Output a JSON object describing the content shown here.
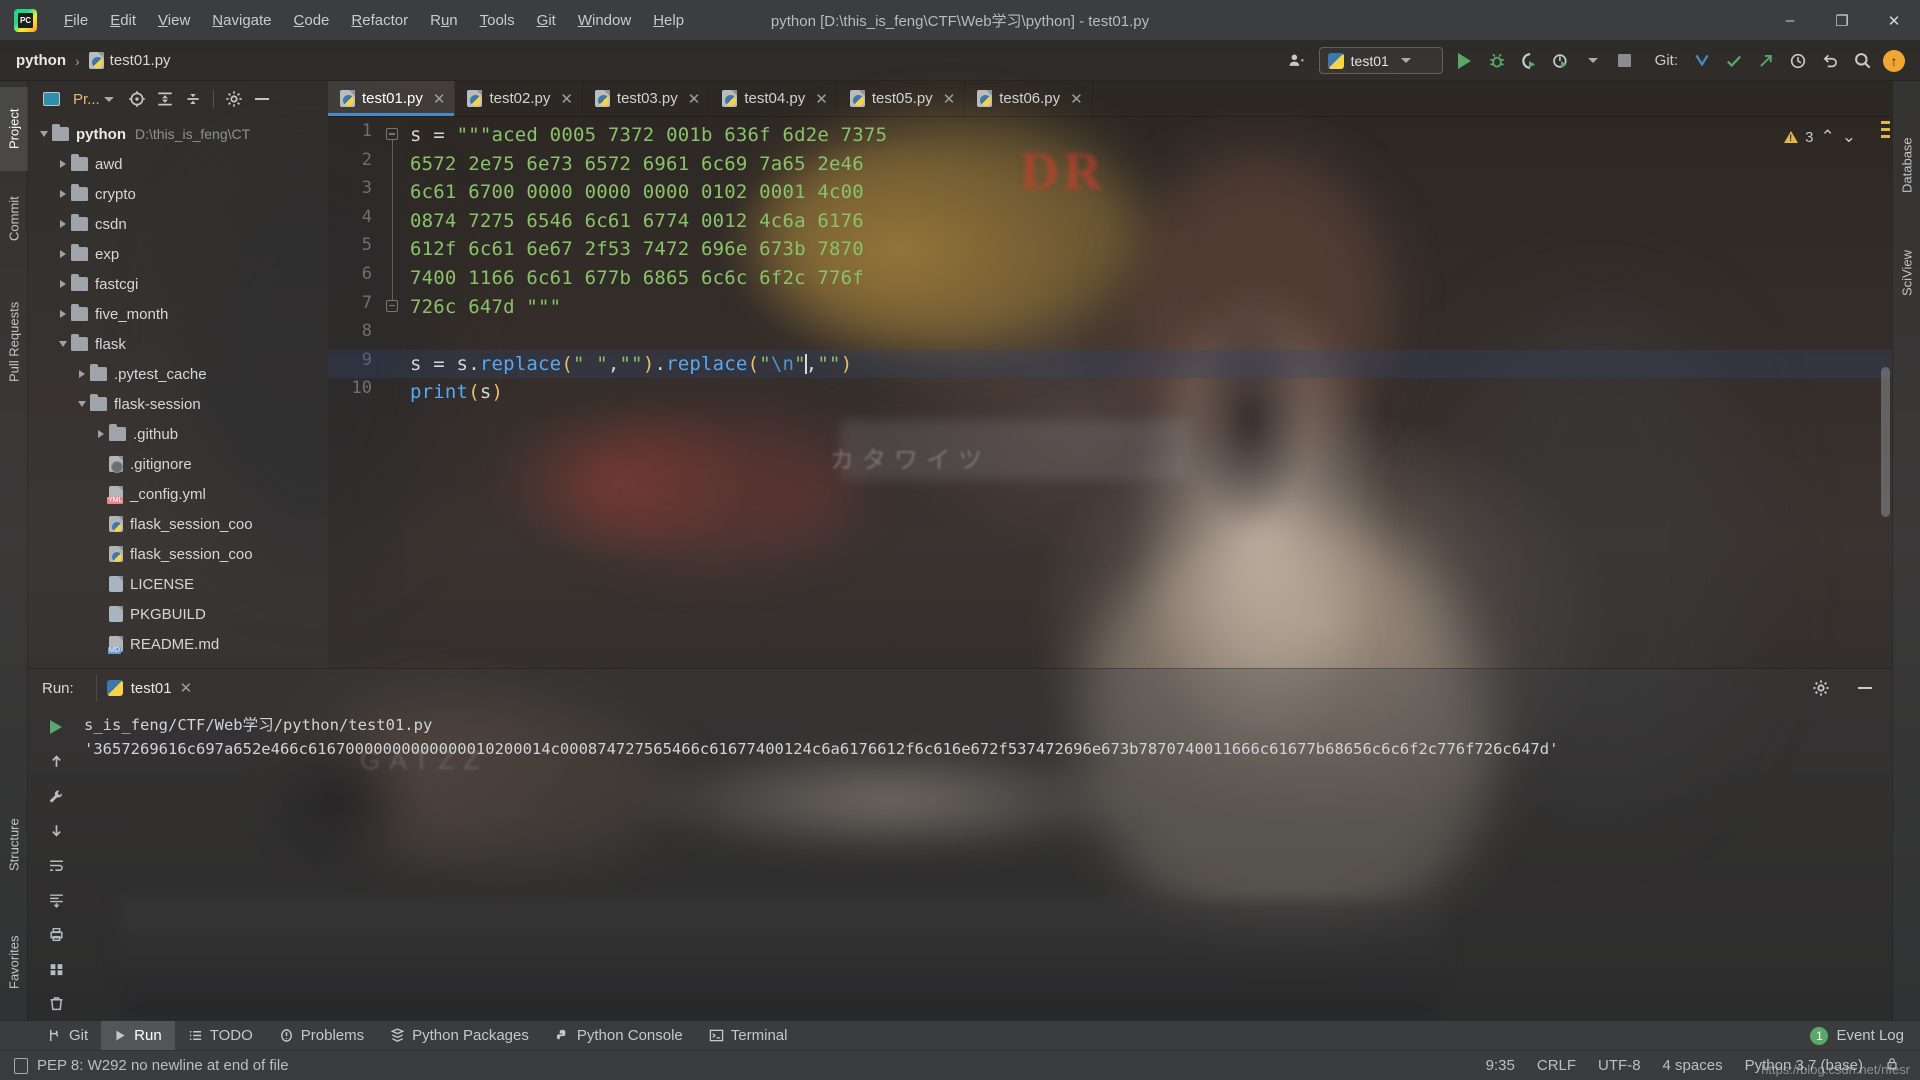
{
  "window": {
    "title": "python [D:\\this_is_feng\\CTF\\Web学习\\python] - test01.py",
    "app_icon": "pycharm-logo-icon",
    "minimize": "–",
    "maximize": "❐",
    "close": "✕"
  },
  "menubar": {
    "items": [
      {
        "label": "File",
        "mnemonic": "F"
      },
      {
        "label": "Edit",
        "mnemonic": "E"
      },
      {
        "label": "View",
        "mnemonic": "V"
      },
      {
        "label": "Navigate",
        "mnemonic": "N"
      },
      {
        "label": "Code",
        "mnemonic": "C"
      },
      {
        "label": "Refactor",
        "mnemonic": "R"
      },
      {
        "label": "Run",
        "mnemonic": "u"
      },
      {
        "label": "Tools",
        "mnemonic": "T"
      },
      {
        "label": "Git",
        "mnemonic": "G"
      },
      {
        "label": "Window",
        "mnemonic": "W"
      },
      {
        "label": "Help",
        "mnemonic": "H"
      }
    ]
  },
  "navbar": {
    "breadcrumb": {
      "project": "python",
      "separator": "›",
      "file": "test01.py"
    },
    "run_config": {
      "name": "test01",
      "icon": "python-config-icon"
    },
    "git_label": "Git:",
    "icons": [
      "account-icon",
      "run-icon",
      "debug-icon",
      "run-coverage-icon",
      "profile-icon",
      "stop-icon",
      "git-update-icon",
      "git-commit-icon",
      "git-push-icon",
      "history-icon",
      "rollback-icon",
      "search-everywhere-icon",
      "updates-badge-icon"
    ],
    "updates_badge": "↑"
  },
  "left_strip": {
    "tabs": [
      {
        "label": "Project",
        "selected": true
      },
      {
        "label": "Commit",
        "selected": false
      },
      {
        "label": "Pull Requests",
        "selected": false
      }
    ],
    "bottom_tabs": [
      {
        "label": "Structure",
        "selected": false
      },
      {
        "label": "Favorites",
        "selected": false
      }
    ]
  },
  "right_strip": {
    "tabs": [
      {
        "label": "Database",
        "selected": false
      },
      {
        "label": "SciView",
        "selected": false
      }
    ]
  },
  "project_panel": {
    "title": "Pr...",
    "header_icons": [
      "select-opened-file-icon",
      "expand-all-icon",
      "collapse-all-icon",
      "settings-gear-icon",
      "hide-panel-icon"
    ],
    "tree": [
      {
        "label": "python",
        "detail": "D:\\this_is_feng\\CT",
        "type": "folder",
        "depth": 0,
        "state": "open",
        "bold": true
      },
      {
        "label": "awd",
        "detail": "",
        "type": "folder",
        "depth": 1,
        "state": "closed",
        "bold": false
      },
      {
        "label": "crypto",
        "detail": "",
        "type": "folder",
        "depth": 1,
        "state": "closed",
        "bold": false
      },
      {
        "label": "csdn",
        "detail": "",
        "type": "folder",
        "depth": 1,
        "state": "closed",
        "bold": false
      },
      {
        "label": "exp",
        "detail": "",
        "type": "folder",
        "depth": 1,
        "state": "closed",
        "bold": false
      },
      {
        "label": "fastcgi",
        "detail": "",
        "type": "folder",
        "depth": 1,
        "state": "closed",
        "bold": false
      },
      {
        "label": "five_month",
        "detail": "",
        "type": "folder",
        "depth": 1,
        "state": "closed",
        "bold": false
      },
      {
        "label": "flask",
        "detail": "",
        "type": "folder",
        "depth": 1,
        "state": "open",
        "bold": false
      },
      {
        "label": ".pytest_cache",
        "detail": "",
        "type": "folder",
        "depth": 2,
        "state": "closed",
        "bold": false
      },
      {
        "label": "flask-session",
        "detail": "",
        "type": "folder",
        "depth": 2,
        "state": "open",
        "bold": false
      },
      {
        "label": ".github",
        "detail": "",
        "type": "folder",
        "depth": 3,
        "state": "closed",
        "bold": false
      },
      {
        "label": ".gitignore",
        "detail": "",
        "type": "file-ignored",
        "depth": 3,
        "state": "none",
        "bold": false
      },
      {
        "label": "_config.yml",
        "detail": "",
        "type": "file-yml",
        "depth": 3,
        "state": "none",
        "bold": false
      },
      {
        "label": "flask_session_coo",
        "detail": "",
        "type": "file-py",
        "depth": 3,
        "state": "none",
        "bold": false
      },
      {
        "label": "flask_session_coo",
        "detail": "",
        "type": "file-py",
        "depth": 3,
        "state": "none",
        "bold": false
      },
      {
        "label": "LICENSE",
        "detail": "",
        "type": "file-txt",
        "depth": 3,
        "state": "none",
        "bold": false
      },
      {
        "label": "PKGBUILD",
        "detail": "",
        "type": "file-txt",
        "depth": 3,
        "state": "none",
        "bold": false
      },
      {
        "label": "README.md",
        "detail": "",
        "type": "file-md",
        "depth": 3,
        "state": "none",
        "bold": false
      }
    ]
  },
  "editor": {
    "tabs": [
      {
        "label": "test01.py",
        "active": true
      },
      {
        "label": "test02.py",
        "active": false
      },
      {
        "label": "test03.py",
        "active": false
      },
      {
        "label": "test04.py",
        "active": false
      },
      {
        "label": "test05.py",
        "active": false
      },
      {
        "label": "test06.py",
        "active": false
      }
    ],
    "tab_close": "✕",
    "inspection": {
      "count": "3",
      "up": "⌃",
      "down": "⌄"
    },
    "line_numbers": [
      "1",
      "2",
      "3",
      "4",
      "5",
      "6",
      "7",
      "8",
      "9",
      "10"
    ],
    "code_lines": [
      {
        "n": 1,
        "tokens": [
          {
            "t": "s = ",
            "c": "plain"
          },
          {
            "t": "\"\"\"aced 0005 7372 001b 636f 6d2e 7375",
            "c": "str"
          }
        ]
      },
      {
        "n": 2,
        "tokens": [
          {
            "t": "6572 2e75 6e73 6572 6961 6c69 7a65 2e46",
            "c": "str"
          }
        ]
      },
      {
        "n": 3,
        "tokens": [
          {
            "t": "6c61 6700 0000 0000 0000 0102 0001 4c00",
            "c": "str"
          }
        ]
      },
      {
        "n": 4,
        "tokens": [
          {
            "t": "0874 7275 6546 6c61 6774 0012 4c6a 6176",
            "c": "str"
          }
        ]
      },
      {
        "n": 5,
        "tokens": [
          {
            "t": "612f 6c61 6e67 2f53 7472 696e 673b 7870",
            "c": "str"
          }
        ]
      },
      {
        "n": 6,
        "tokens": [
          {
            "t": "7400 1166 6c61 677b 6865 6c6c 6f2c 776f",
            "c": "str"
          }
        ]
      },
      {
        "n": 7,
        "tokens": [
          {
            "t": "726c 647d \"\"\"",
            "c": "str"
          }
        ]
      },
      {
        "n": 8,
        "tokens": []
      },
      {
        "n": 9,
        "tokens": [
          {
            "t": "s = s.",
            "c": "plain"
          },
          {
            "t": "replace",
            "c": "fn"
          },
          {
            "t": "(",
            "c": "paren"
          },
          {
            "t": "\" \"",
            "c": "str"
          },
          {
            "t": ",",
            "c": "plain"
          },
          {
            "t": "\"\"",
            "c": "str"
          },
          {
            "t": ")",
            "c": "paren"
          },
          {
            "t": ".",
            "c": "plain"
          },
          {
            "t": "replace",
            "c": "fn"
          },
          {
            "t": "(",
            "c": "paren"
          },
          {
            "t": "\"",
            "c": "str"
          },
          {
            "t": "\\n",
            "c": "esc"
          },
          {
            "t": "\"",
            "c": "str"
          },
          {
            "t": "|",
            "c": "caret"
          },
          {
            "t": ",",
            "c": "plain"
          },
          {
            "t": "\"\"",
            "c": "str"
          },
          {
            "t": ")",
            "c": "paren"
          }
        ]
      },
      {
        "n": 10,
        "tokens": [
          {
            "t": "print",
            "c": "fn"
          },
          {
            "t": "(",
            "c": "paren"
          },
          {
            "t": "s",
            "c": "plain"
          },
          {
            "t": ")",
            "c": "paren"
          }
        ]
      }
    ]
  },
  "run_panel": {
    "label": "Run:",
    "tab_name": "test01",
    "tab_close": "✕",
    "toolbar_icons": [
      "rerun-icon",
      "scroll-up-icon",
      "wrench-icon",
      "scroll-down-icon",
      "soft-wrap-icon",
      "pin-icon",
      "scroll-to-end-icon",
      "print-icon",
      "layout-icon",
      "trash-icon"
    ],
    "header_icons": [
      "settings-gear-icon",
      "hide-panel-icon"
    ],
    "console_lines": [
      "s_is_feng/CTF/Web学习/python/test01.py",
      "'3657269616c697a652e466c61670000000000000010200014c000874727565466c61677400124c6a6176612f6c616e672f537472696e673b7870740011666c61677b68656c6c6f2c776f726c647d'"
    ]
  },
  "bottombar": {
    "items": [
      {
        "label": "Git",
        "icon": "git-branch-icon",
        "selected": false
      },
      {
        "label": "Run",
        "icon": "run-icon",
        "selected": true
      },
      {
        "label": "TODO",
        "icon": "todo-list-icon",
        "selected": false
      },
      {
        "label": "Problems",
        "icon": "problems-icon",
        "selected": false
      },
      {
        "label": "Python Packages",
        "icon": "packages-icon",
        "selected": false
      },
      {
        "label": "Python Console",
        "icon": "python-console-icon",
        "selected": false
      },
      {
        "label": "Terminal",
        "icon": "terminal-icon",
        "selected": false
      }
    ],
    "event_log": {
      "label": "Event Log",
      "count": "1"
    }
  },
  "statusbar": {
    "message": "PEP 8: W292 no newline at end of file",
    "message_icon": "inspection-book-icon",
    "caret_position": "9:35",
    "line_separator": "CRLF",
    "encoding": "UTF-8",
    "indent": "4 spaces",
    "interpreter": "Python 3.7 (base)",
    "lock_icon": "lock-icon"
  },
  "watermark": "https://blog.csdn.net/nfesr",
  "wallpaper": {
    "sign_dr": "DR",
    "sign_gatzz": "GATZZ",
    "sign_kana": "カタワイツ"
  },
  "colors": {
    "accent_blue": "#4a88c7",
    "run_green": "#59a869",
    "string_green": "#8ac26a",
    "keyword_orange": "#cc7832",
    "function_blue": "#56a8f5",
    "paren_yellow": "#e8bf6a",
    "warning_yellow": "#e0b843",
    "panel_bg": "#3c3f41",
    "project_title": "#e3b870"
  }
}
